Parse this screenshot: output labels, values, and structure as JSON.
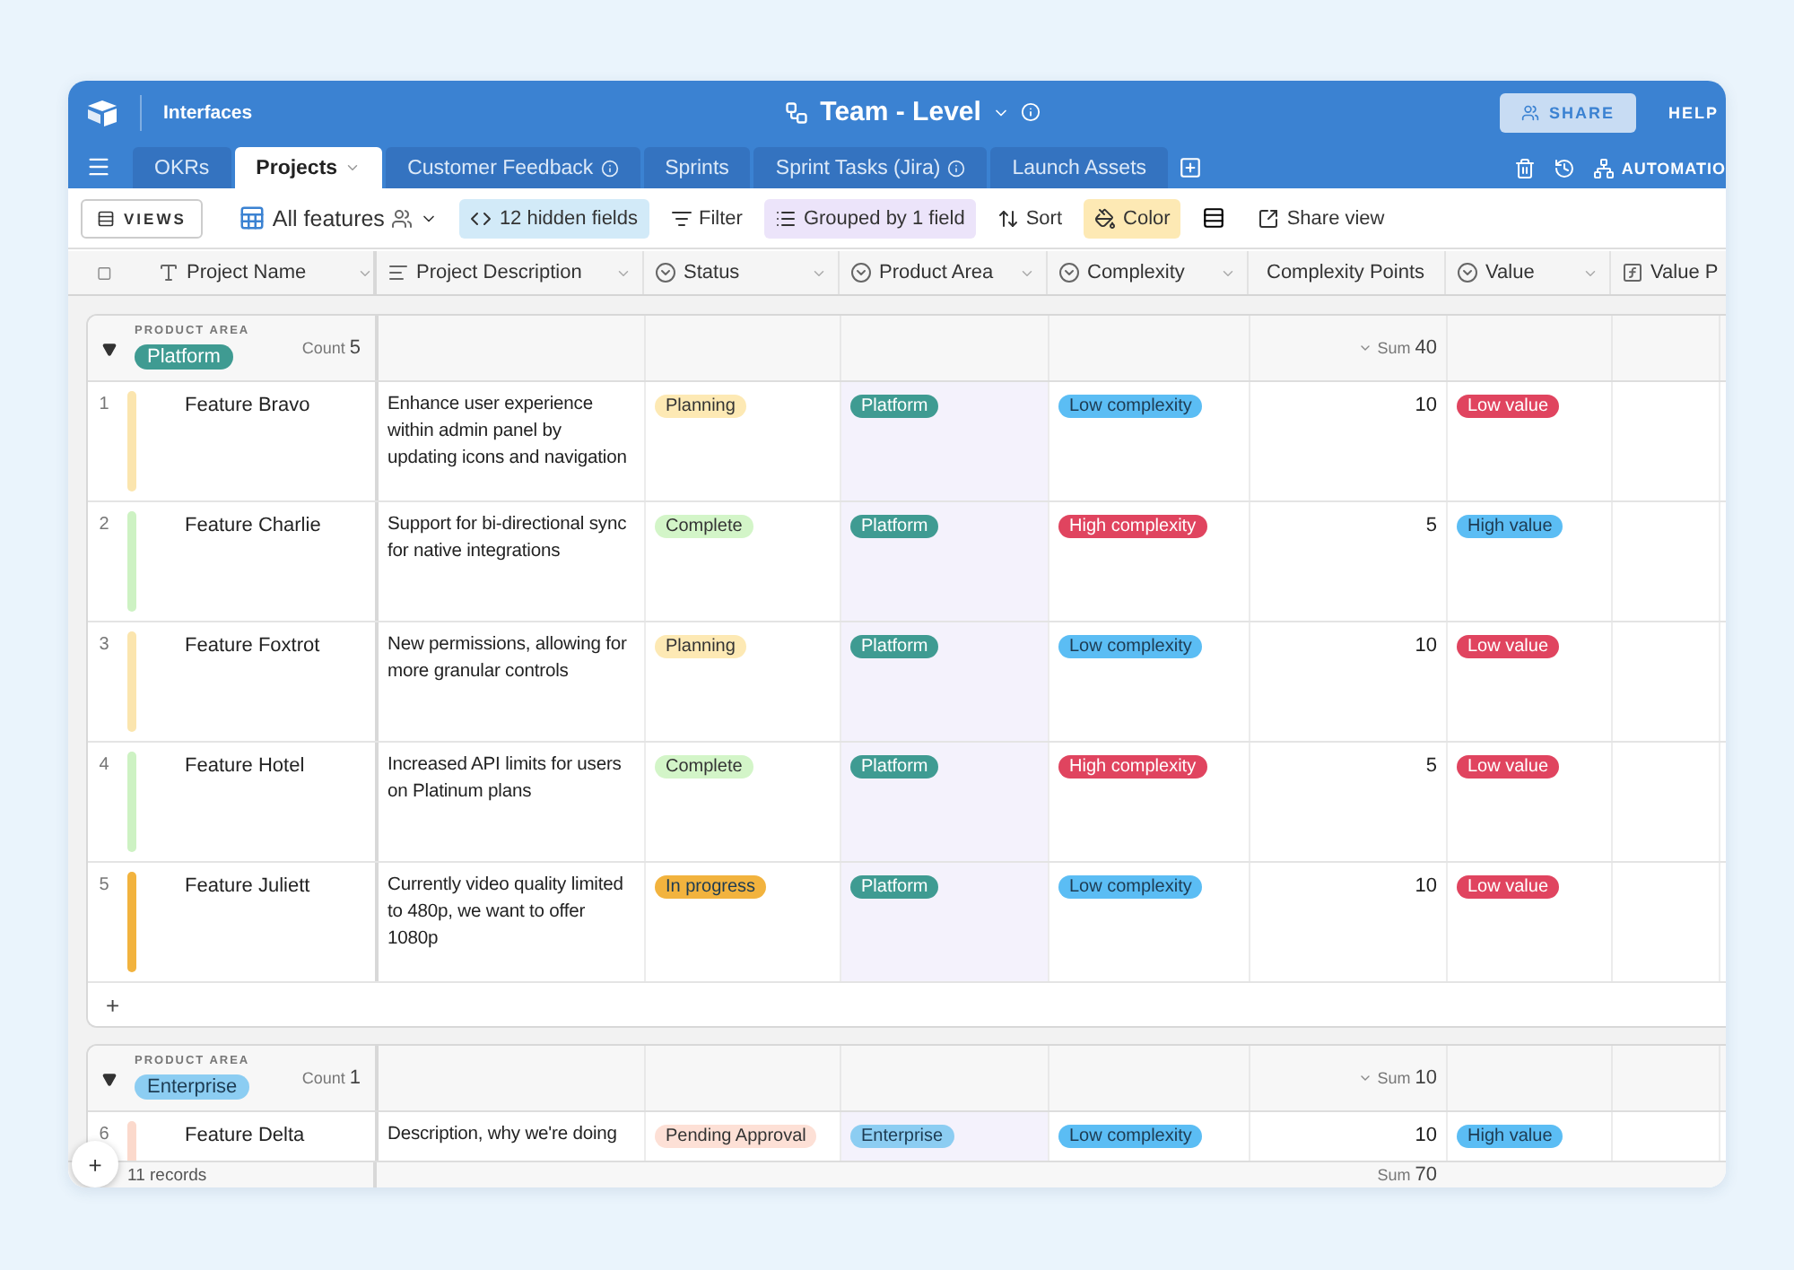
{
  "header": {
    "nav_link": "Interfaces",
    "title": "Team - Level",
    "share": "SHARE",
    "help": "HELP",
    "automations": "AUTOMATIO"
  },
  "tabs": [
    {
      "label": "OKRs",
      "selected": false,
      "info": false
    },
    {
      "label": "Projects",
      "selected": true,
      "info": false
    },
    {
      "label": "Customer Feedback",
      "selected": false,
      "info": true
    },
    {
      "label": "Sprints",
      "selected": false,
      "info": false
    },
    {
      "label": "Sprint Tasks (Jira)",
      "selected": false,
      "info": true
    },
    {
      "label": "Launch Assets",
      "selected": false,
      "info": false
    }
  ],
  "toolbar": {
    "views": "VIEWS",
    "view_name": "All features",
    "hidden_fields": "12 hidden fields",
    "filter": "Filter",
    "grouped": "Grouped by 1 field",
    "sort": "Sort",
    "color_button": "Color",
    "share_view": "Share view"
  },
  "select_all_checked": false,
  "columns": [
    {
      "label": "Project Name",
      "kind": "text"
    },
    {
      "label": "Project Description",
      "kind": "longtext"
    },
    {
      "label": "Status",
      "kind": "select"
    },
    {
      "label": "Product Area",
      "kind": "select"
    },
    {
      "label": "Complexity",
      "kind": "select"
    },
    {
      "label": "Complexity Points",
      "kind": "formula"
    },
    {
      "label": "Value",
      "kind": "select"
    },
    {
      "label": "Value P",
      "kind": "formula"
    }
  ],
  "groups": [
    {
      "field_label": "PRODUCT AREA",
      "name": "Platform",
      "color": "#3f9b92",
      "expanded": true,
      "count_label": "Count",
      "count": "5",
      "sum_label": "Sum",
      "sum": "40",
      "add_row": "+",
      "rows": [
        {
          "number": "1",
          "name": "Feature Bravo",
          "color": "#fbe5ae",
          "description": "Enhance user experience within admin panel by updating icons and navigation",
          "status": {
            "label": "Planning",
            "color": "#fde9b4"
          },
          "area": {
            "label": "Platform",
            "color": "#3f9b92"
          },
          "complexity": {
            "label": "Low complexity",
            "color": "#5bbdf4"
          },
          "points": "10",
          "value": {
            "label": "Low value",
            "color": "#e0445f"
          }
        },
        {
          "number": "2",
          "name": "Feature Charlie",
          "color": "#cdf2c3",
          "description": "Support for bi-directional sync for native integrations",
          "status": {
            "label": "Complete",
            "color": "#d3f5c8"
          },
          "area": {
            "label": "Platform",
            "color": "#3f9b92"
          },
          "complexity": {
            "label": "High complexity",
            "color": "#e0445f"
          },
          "points": "5",
          "value": {
            "label": "High value",
            "color": "#5bbdf4"
          }
        },
        {
          "number": "3",
          "name": "Feature Foxtrot",
          "color": "#fbe5ae",
          "description": "New permissions, allowing for more granular controls",
          "status": {
            "label": "Planning",
            "color": "#fde9b4"
          },
          "area": {
            "label": "Platform",
            "color": "#3f9b92"
          },
          "complexity": {
            "label": "Low complexity",
            "color": "#5bbdf4"
          },
          "points": "10",
          "value": {
            "label": "Low value",
            "color": "#e0445f"
          }
        },
        {
          "number": "4",
          "name": "Feature Hotel",
          "color": "#cdf2c3",
          "description": "Increased API limits for users on Platinum plans",
          "status": {
            "label": "Complete",
            "color": "#d3f5c8"
          },
          "area": {
            "label": "Platform",
            "color": "#3f9b92"
          },
          "complexity": {
            "label": "High complexity",
            "color": "#e0445f"
          },
          "points": "5",
          "value": {
            "label": "Low value",
            "color": "#e0445f"
          }
        },
        {
          "number": "5",
          "name": "Feature Juliett",
          "color": "#f2b33e",
          "description": "Currently video quality limited to 480p, we want to offer 1080p",
          "status": {
            "label": "In progress",
            "color": "#f2b33e"
          },
          "area": {
            "label": "Platform",
            "color": "#3f9b92"
          },
          "complexity": {
            "label": "Low complexity",
            "color": "#5bbdf4"
          },
          "points": "10",
          "value": {
            "label": "Low value",
            "color": "#e0445f"
          }
        }
      ]
    },
    {
      "field_label": "PRODUCT AREA",
      "name": "Enterprise",
      "color": "#8ccdf2",
      "expanded": true,
      "count_label": "Count",
      "count": "1",
      "sum_label": "Sum",
      "sum": "10",
      "rows": [
        {
          "number": "6",
          "name": "Feature Delta",
          "color": "#fbd9cc",
          "description": "Description, why we're doing",
          "status": {
            "label": "Pending Approval",
            "color": "#fde0d6"
          },
          "area": {
            "label": "Enterprise",
            "color": "#8ccdf2"
          },
          "complexity": {
            "label": "Low complexity",
            "color": "#5bbdf4"
          },
          "points": "10",
          "value": {
            "label": "High value",
            "color": "#5bbdf4"
          }
        }
      ]
    }
  ],
  "footer": {
    "records": "11 records",
    "sum_label": "Sum",
    "sum": "70",
    "add": "+"
  }
}
